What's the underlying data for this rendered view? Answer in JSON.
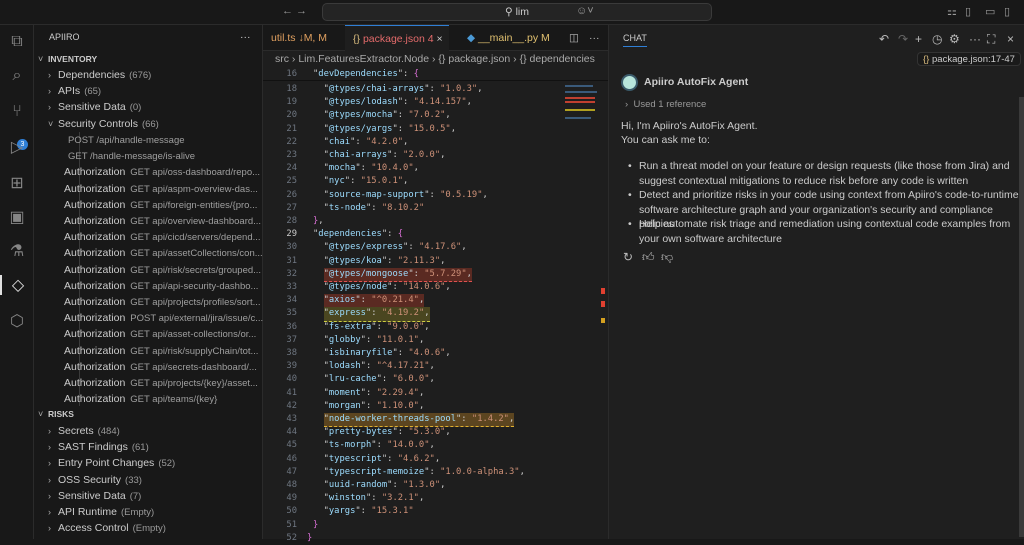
{
  "titlebar": {
    "search": "lim",
    "back_icon": "arrow-left-icon",
    "forward_icon": "arrow-right-icon",
    "copilot_icon": "copilot-icon"
  },
  "activity": {
    "items": [
      "explorer",
      "search",
      "source-control",
      "run-debug",
      "extensions",
      "remote-explorer",
      "testing",
      "apiiro",
      "containers"
    ],
    "source_control_badge": "3"
  },
  "sidebar": {
    "title": "APIIRO",
    "more": "···",
    "inventory_label": "INVENTORY",
    "inventory": [
      {
        "label": "Dependencies",
        "count": "(676)"
      },
      {
        "label": "APIs",
        "count": "(65)"
      },
      {
        "label": "Sensitive Data",
        "count": "(0)"
      },
      {
        "label": "Security Controls",
        "count": "(66)",
        "expanded": true
      }
    ],
    "security_controls": [
      {
        "kind": "",
        "endpoint": "POST /api/handle-message"
      },
      {
        "kind": "",
        "endpoint": "GET /handle-message/is-alive"
      },
      {
        "kind": "Authorization",
        "endpoint": "GET api/oss-dashboard/repo..."
      },
      {
        "kind": "Authorization",
        "endpoint": "GET api/aspm-overview-das..."
      },
      {
        "kind": "Authorization",
        "endpoint": "GET api/foreign-entities/{pro..."
      },
      {
        "kind": "Authorization",
        "endpoint": "GET api/overview-dashboard..."
      },
      {
        "kind": "Authorization",
        "endpoint": "GET api/cicd/servers/depend..."
      },
      {
        "kind": "Authorization",
        "endpoint": "GET api/assetCollections/con..."
      },
      {
        "kind": "Authorization",
        "endpoint": "GET api/risk/secrets/grouped..."
      },
      {
        "kind": "Authorization",
        "endpoint": "GET api/api-security-dashbo..."
      },
      {
        "kind": "Authorization",
        "endpoint": "GET api/projects/profiles/sort..."
      },
      {
        "kind": "Authorization",
        "endpoint": "POST api/external/jira/issue/c..."
      },
      {
        "kind": "Authorization",
        "endpoint": "GET api/asset-collections/or..."
      },
      {
        "kind": "Authorization",
        "endpoint": "GET api/risk/supplyChain/tot..."
      },
      {
        "kind": "Authorization",
        "endpoint": "GET api/secrets-dashboard/..."
      },
      {
        "kind": "Authorization",
        "endpoint": "GET api/projects/{key}/asset..."
      },
      {
        "kind": "Authorization",
        "endpoint": "GET api/teams/{key}"
      }
    ],
    "risks_label": "RISKS",
    "risks": [
      {
        "label": "Secrets",
        "count": "(484)"
      },
      {
        "label": "SAST Findings",
        "count": "(61)"
      },
      {
        "label": "Entry Point Changes",
        "count": "(52)"
      },
      {
        "label": "OSS Security",
        "count": "(33)"
      },
      {
        "label": "Sensitive Data",
        "count": "(7)"
      },
      {
        "label": "API Runtime",
        "count": "(Empty)"
      },
      {
        "label": "Access Control",
        "count": "(Empty)"
      }
    ]
  },
  "editor": {
    "tabs": [
      {
        "label": "util.ts",
        "status": "↓M, M"
      },
      {
        "label": "package.json",
        "status": "4",
        "active": true
      },
      {
        "label": "__main__.py",
        "status": "M"
      }
    ],
    "breadcrumb": [
      "src",
      "Lim.FeaturesExtractor.Node",
      "{} package.json",
      "{} dependencies"
    ],
    "lines": [
      {
        "n": "16",
        "i": 1,
        "k": "devDependencies",
        "p": ": ",
        "b": "{"
      },
      {
        "n": "18",
        "i": 2,
        "k": "@types/chai-arrays",
        "v": "1.0.3",
        "p": ","
      },
      {
        "n": "19",
        "i": 2,
        "k": "@types/lodash",
        "v": "4.14.157",
        "p": ","
      },
      {
        "n": "20",
        "i": 2,
        "k": "@types/mocha",
        "v": "7.0.2",
        "p": ","
      },
      {
        "n": "21",
        "i": 2,
        "k": "@types/yargs",
        "v": "15.0.5",
        "p": ","
      },
      {
        "n": "22",
        "i": 2,
        "k": "chai",
        "v": "4.2.0",
        "p": ","
      },
      {
        "n": "23",
        "i": 2,
        "k": "chai-arrays",
        "v": "2.0.0",
        "p": ","
      },
      {
        "n": "24",
        "i": 2,
        "k": "mocha",
        "v": "10.4.0",
        "p": ","
      },
      {
        "n": "25",
        "i": 2,
        "k": "nyc",
        "v": "15.0.1",
        "p": ","
      },
      {
        "n": "26",
        "i": 2,
        "k": "source-map-support",
        "v": "0.5.19",
        "p": ","
      },
      {
        "n": "27",
        "i": 2,
        "k": "ts-node",
        "v": "8.10.2"
      },
      {
        "n": "28",
        "i": 1,
        "b": "}",
        "p": ","
      },
      {
        "n": "29",
        "i": 1,
        "k": "dependencies",
        "p": ": ",
        "b": "{",
        "cur": true
      },
      {
        "n": "30",
        "i": 2,
        "k": "@types/express",
        "v": "4.17.6",
        "p": ","
      },
      {
        "n": "31",
        "i": 2,
        "k": "@types/koa",
        "v": "2.11.3",
        "p": ","
      },
      {
        "n": "32",
        "i": 2,
        "k": "@types/mongoose",
        "v": "5.7.29",
        "p": ",",
        "hl": "red"
      },
      {
        "n": "33",
        "i": 2,
        "k": "@types/node",
        "v": "14.0.6",
        "p": ","
      },
      {
        "n": "34",
        "i": 2,
        "k": "axios",
        "v": "^0.21.4",
        "p": ",",
        "hl": "red"
      },
      {
        "n": "35",
        "i": 2,
        "k": "express",
        "v": "4.19.2",
        "p": ",",
        "hl": "olive"
      },
      {
        "n": "36",
        "i": 2,
        "k": "fs-extra",
        "v": "9.0.0",
        "p": ","
      },
      {
        "n": "37",
        "i": 2,
        "k": "globby",
        "v": "11.0.1",
        "p": ","
      },
      {
        "n": "38",
        "i": 2,
        "k": "isbinaryfile",
        "v": "4.0.6",
        "p": ","
      },
      {
        "n": "39",
        "i": 2,
        "k": "lodash",
        "v": "^4.17.21",
        "p": ","
      },
      {
        "n": "40",
        "i": 2,
        "k": "lru-cache",
        "v": "6.0.0",
        "p": ","
      },
      {
        "n": "41",
        "i": 2,
        "k": "moment",
        "v": "2.29.4",
        "p": ","
      },
      {
        "n": "42",
        "i": 2,
        "k": "morgan",
        "v": "1.10.0",
        "p": ","
      },
      {
        "n": "43",
        "i": 2,
        "k": "node-worker-threads-pool",
        "v": "1.4.2",
        "p": ",",
        "hl": "amber"
      },
      {
        "n": "44",
        "i": 2,
        "k": "pretty-bytes",
        "v": "5.3.0",
        "p": ","
      },
      {
        "n": "45",
        "i": 2,
        "k": "ts-morph",
        "v": "14.0.0",
        "p": ","
      },
      {
        "n": "46",
        "i": 2,
        "k": "typescript",
        "v": "4.6.2",
        "p": ","
      },
      {
        "n": "47",
        "i": 2,
        "k": "typescript-memoize",
        "v": "1.0.0-alpha.3",
        "p": ","
      },
      {
        "n": "48",
        "i": 2,
        "k": "uuid-random",
        "v": "1.3.0",
        "p": ","
      },
      {
        "n": "49",
        "i": 2,
        "k": "winston",
        "v": "3.2.1",
        "p": ","
      },
      {
        "n": "50",
        "i": 2,
        "k": "yargs",
        "v": "15.3.1"
      },
      {
        "n": "51",
        "i": 1,
        "b": "}"
      },
      {
        "n": "52",
        "i": 0,
        "b": "}"
      }
    ]
  },
  "chat": {
    "tab": "CHAT",
    "context_chip": "package.json:17-47",
    "agent_name": "Apiiro AutoFix Agent",
    "references": "Used 1 reference",
    "greeting": "Hi, I'm Apiiro's AutoFix Agent.",
    "intro": "You can ask me to:",
    "bullets": [
      "Run a threat model on your feature or design requests (like those from Jira) and suggest contextual mitigations to reduce risk before any code is written",
      "Detect and prioritize risks in your code using context from Apiiro's code-to-runtime software architecture graph and your organization's security and compliance policies",
      "Help automate risk triage and remediation using contextual code examples from your own software architecture"
    ]
  },
  "colors": {
    "accent": "#2f7fd6",
    "error": "#e05050",
    "warning": "#e0b030"
  }
}
